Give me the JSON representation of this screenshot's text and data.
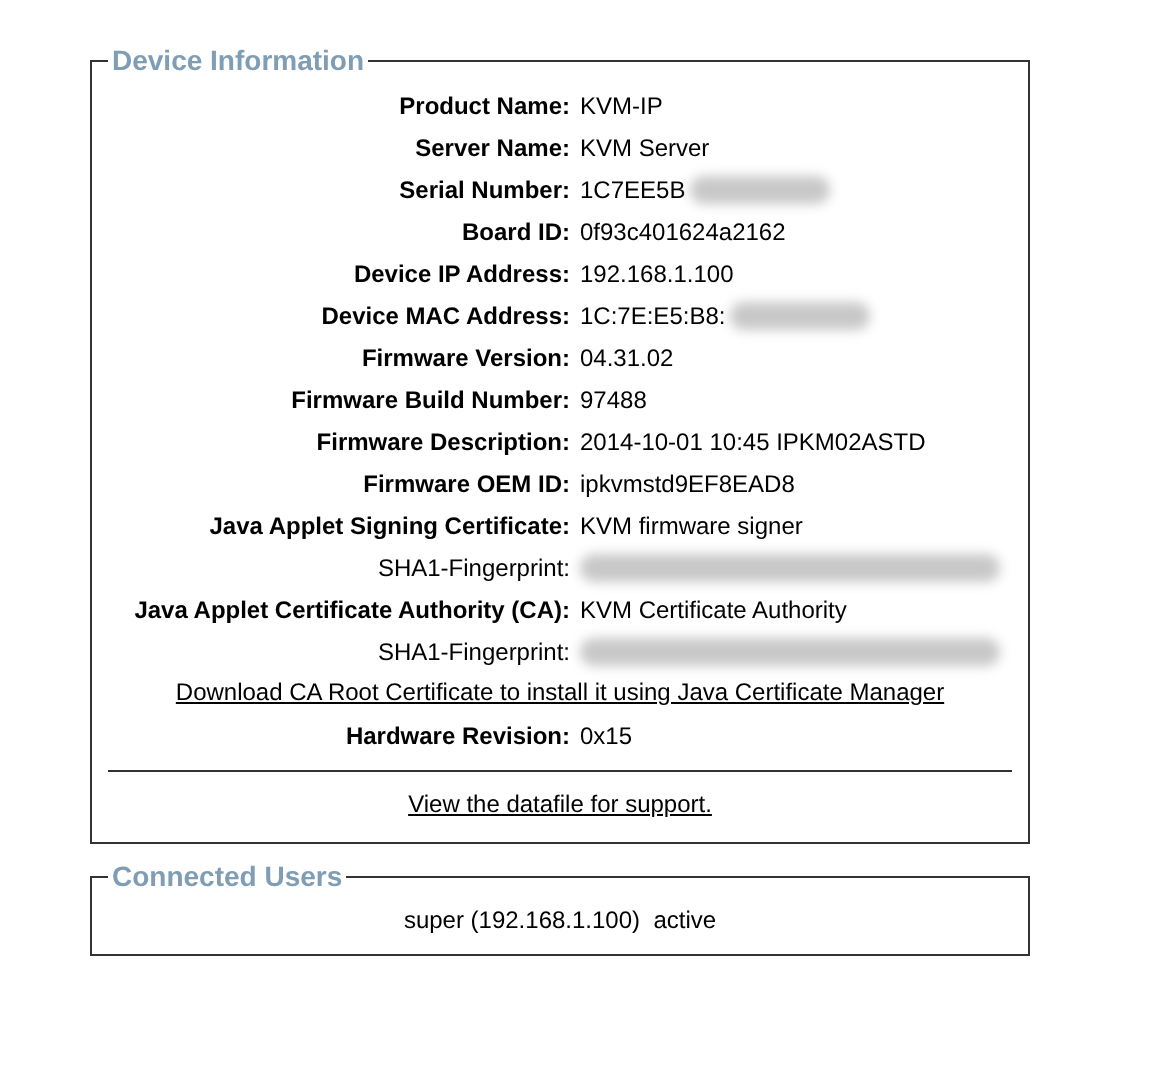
{
  "device_information": {
    "title": "Device Information",
    "rows": [
      {
        "kind": "field",
        "label": "Product Name:",
        "value": "KVM-IP",
        "redacted": false
      },
      {
        "kind": "field",
        "label": "Server Name:",
        "value": "KVM Server",
        "redacted": false
      },
      {
        "kind": "field",
        "label": "Serial Number:",
        "value": "1C7EE5B",
        "redacted": true
      },
      {
        "kind": "field",
        "label": "Board ID:",
        "value": "0f93c401624a2162",
        "redacted": false
      },
      {
        "kind": "field",
        "label": "Device IP Address:",
        "value": "192.168.1.100",
        "redacted": false
      },
      {
        "kind": "field",
        "label": "Device MAC Address:",
        "value": "1C:7E:E5:B8:",
        "redacted": true
      },
      {
        "kind": "field",
        "label": "Firmware Version:",
        "value": "04.31.02",
        "redacted": false
      },
      {
        "kind": "field",
        "label": "Firmware Build Number:",
        "value": "97488",
        "redacted": false
      },
      {
        "kind": "field",
        "label": "Firmware Description:",
        "value": "2014-10-01 10:45 IPKM02ASTD",
        "redacted": false
      },
      {
        "kind": "field",
        "label": "Firmware OEM ID:",
        "value": "ipkvmstd9EF8EAD8",
        "redacted": false
      },
      {
        "kind": "field",
        "label": "Java Applet Signing Certificate:",
        "value": "KVM firmware signer",
        "redacted": false
      },
      {
        "kind": "subfield",
        "label": "SHA1-Fingerprint:",
        "redacted": true
      },
      {
        "kind": "field",
        "label": "Java Applet Certificate Authority (CA):",
        "value": "KVM Certificate Authority",
        "redacted": false
      },
      {
        "kind": "subfield",
        "label": "SHA1-Fingerprint:",
        "redacted": true
      },
      {
        "kind": "link",
        "label": "Download CA Root Certificate to install it using Java Certificate Manager"
      },
      {
        "kind": "field",
        "label": "Hardware Revision:",
        "value": "0x15",
        "redacted": false
      }
    ],
    "footer_link": "View the datafile for support."
  },
  "connected_users": {
    "title": "Connected Users",
    "entries": [
      "super (192.168.1.100)  active"
    ]
  }
}
